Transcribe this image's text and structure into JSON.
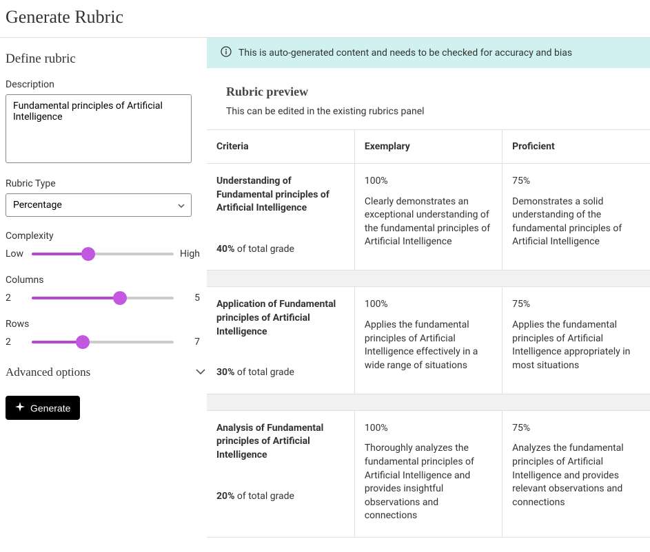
{
  "page_title": "Generate Rubric",
  "sidebar": {
    "heading": "Define rubric",
    "description_label": "Description",
    "description_value": "Fundamental principles of Artificial Intelligence",
    "rubric_type_label": "Rubric Type",
    "rubric_type_value": "Percentage",
    "complexity_label": "Complexity",
    "complexity_min": "Low",
    "complexity_max": "High",
    "complexity_pct": 40,
    "columns_label": "Columns",
    "columns_min": "2",
    "columns_max": "5",
    "columns_pct": 62,
    "rows_label": "Rows",
    "rows_min": "2",
    "rows_max": "7",
    "rows_pct": 36,
    "advanced_label": "Advanced options",
    "generate_label": "Generate"
  },
  "banner_text": "This is auto-generated content and needs to be checked for accuracy and bias",
  "preview": {
    "title": "Rubric preview",
    "subtitle": "This can be edited in the existing rubrics panel"
  },
  "table": {
    "headers": {
      "criteria": "Criteria",
      "exemplary": "Exemplary",
      "proficient": "Proficient"
    },
    "grade_suffix": " of total grade",
    "rows": [
      {
        "criteria": "Understanding of Fundamental principles of Artificial Intelligence",
        "weight": "40%",
        "exemplary_pct": "100%",
        "exemplary_desc": "Clearly demonstrates an exceptional understanding of the fundamental principles of Artificial Intelligence",
        "proficient_pct": "75%",
        "proficient_desc": "Demonstrates a solid understanding of the fundamental principles of Artificial Intelligence"
      },
      {
        "criteria": "Application of Fundamental principles of Artificial Intelligence",
        "weight": "30%",
        "exemplary_pct": "100%",
        "exemplary_desc": "Applies the fundamental principles of Artificial Intelligence effectively in a wide range of situations",
        "proficient_pct": "75%",
        "proficient_desc": "Applies the fundamental principles of Artificial Intelligence appropriately in most situations"
      },
      {
        "criteria": "Analysis of Fundamental principles of Artificial Intelligence",
        "weight": "20%",
        "exemplary_pct": "100%",
        "exemplary_desc": "Thoroughly analyzes the fundamental principles of Artificial Intelligence and provides insightful observations and connections",
        "proficient_pct": "75%",
        "proficient_desc": "Analyzes the fundamental principles of Artificial Intelligence and provides relevant observations and connections"
      }
    ]
  }
}
